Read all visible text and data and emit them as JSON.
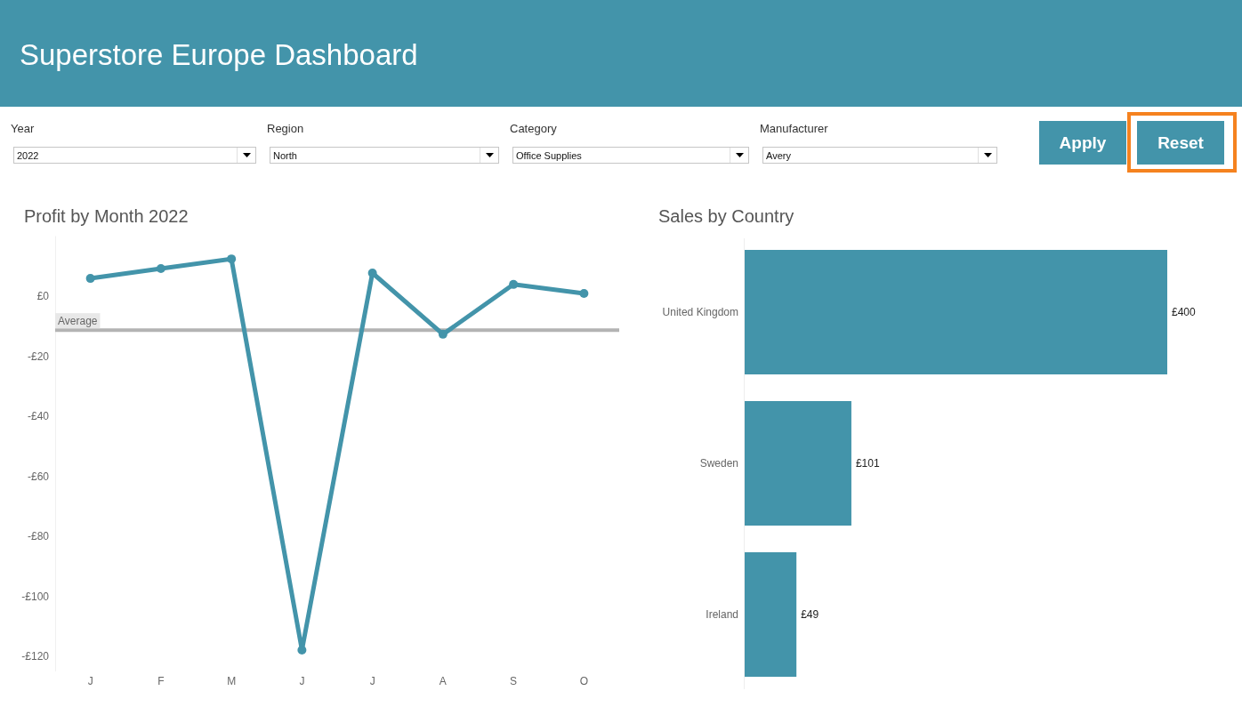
{
  "header": {
    "title": "Superstore Europe Dashboard"
  },
  "filters": [
    {
      "label": "Year",
      "value": "2022"
    },
    {
      "label": "Region",
      "value": "North"
    },
    {
      "label": "Category",
      "value": "Office Supplies"
    },
    {
      "label": "Manufacturer",
      "value": "Avery"
    }
  ],
  "buttons": [
    {
      "label": "Apply",
      "highlighted": false
    },
    {
      "label": "Reset",
      "highlighted": true
    }
  ],
  "profit_chart": {
    "chart_data": {
      "type": "line",
      "title": "Profit by Month 2022",
      "categories": [
        "J",
        "F",
        "M",
        "J",
        "J",
        "A",
        "S",
        "O"
      ],
      "series": [
        {
          "color": "#4394aa",
          "marker": "circle",
          "values": [
            5.9,
            9.2,
            12.4,
            -117.9,
            7.7,
            -12.7,
            3.9,
            0.9
          ]
        }
      ],
      "ylim": [
        -125,
        20
      ],
      "yticks": [
        {
          "value": 0,
          "label": "£0"
        },
        {
          "value": -20,
          "label": "-£20"
        },
        {
          "value": -40,
          "label": "-£40"
        },
        {
          "value": -60,
          "label": "-£60"
        },
        {
          "value": -80,
          "label": "-£80"
        },
        {
          "value": -100,
          "label": "-£100"
        },
        {
          "value": -120,
          "label": "-£120"
        }
      ],
      "ref_lines": [
        {
          "axis": "y",
          "value": -11.3,
          "label": "Average"
        }
      ]
    }
  },
  "sales_chart": {
    "chart_data": {
      "type": "bar",
      "orientation": "horizontal",
      "title": "Sales by Country",
      "categories": [
        "United Kingdom",
        "Sweden",
        "Ireland"
      ],
      "values": [
        400,
        101,
        49
      ],
      "value_labels": [
        "£400",
        "£101",
        "£49"
      ]
    }
  }
}
